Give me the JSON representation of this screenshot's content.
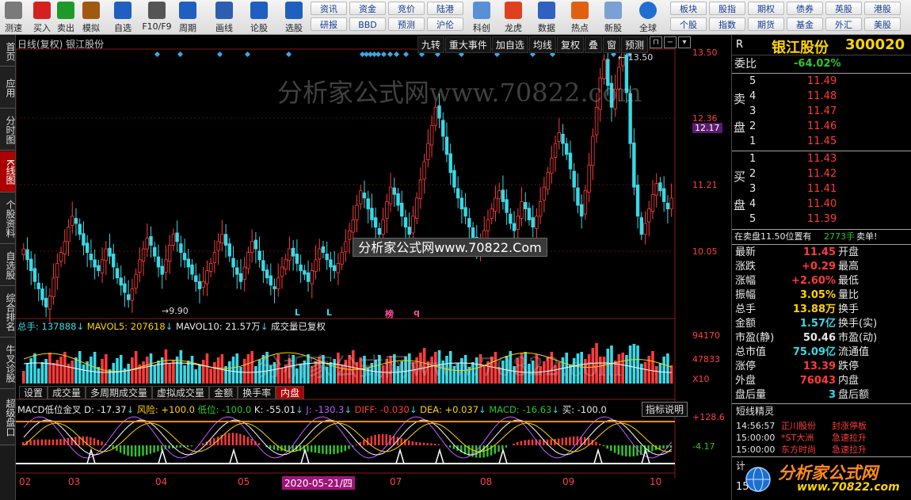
{
  "toolbar": {
    "buttons": [
      {
        "label": "测速",
        "icon": "speed-test-icon"
      },
      {
        "label": "买入",
        "icon": "buy-icon"
      },
      {
        "label": "卖出",
        "icon": "sell-icon"
      },
      {
        "label": "模拟",
        "icon": "hammer-icon"
      },
      {
        "label": "自选",
        "icon": "star-icon"
      },
      {
        "label": "F10/F9",
        "icon": "f10-icon"
      },
      {
        "label": "周期",
        "icon": "clock-icon"
      },
      {
        "label": "画线",
        "icon": "pen-icon"
      },
      {
        "label": "论股",
        "icon": "discuss-icon"
      },
      {
        "label": "选股",
        "icon": "select-stock-icon"
      }
    ],
    "grid1": [
      "资讯",
      "资金",
      "竞价",
      "陆港",
      "研报",
      "BBD",
      "预测",
      "沪伦"
    ],
    "buttons2": [
      {
        "label": "科创",
        "icon": "kechuang-icon"
      },
      {
        "label": "龙虎",
        "icon": "dragon-tiger-icon"
      },
      {
        "label": "数据",
        "icon": "data-icon"
      },
      {
        "label": "热点",
        "icon": "hotspot-icon"
      },
      {
        "label": "新股",
        "icon": "ipo-icon"
      },
      {
        "label": "全球",
        "icon": "globe-icon"
      }
    ],
    "grid2": [
      "板块",
      "股指",
      "期权",
      "债券",
      "英股",
      "港股",
      "个股",
      "指数",
      "期货",
      "基金",
      "外汇",
      "美股"
    ]
  },
  "left_tabs": [
    "首页",
    "应用",
    "分时图",
    "K线图",
    "个股资料",
    "自选股",
    "综合排名",
    "牛叉诊股",
    "超级盘口"
  ],
  "chart": {
    "title": "日线(复权) 银江股份",
    "tabs": [
      "九转",
      "重大事件",
      "加自选",
      "均线",
      "复权",
      "叠",
      "窗",
      "预测"
    ],
    "price_axis": [
      "13.50",
      "12.36",
      "12.17",
      "11.21",
      "10.05"
    ],
    "high_label": "13.50",
    "low_label": "9.90",
    "marks": [
      "L",
      "L",
      "榜",
      "q"
    ],
    "vol_line": {
      "label": "总手: 137888",
      "ma5": "MAVOL5: 207618",
      "ma10": "MAVOL10: 21.57万",
      "note": "成交量已复权"
    },
    "vol_axis": [
      "94170",
      "47833",
      "X10"
    ],
    "vol_tabs": [
      "设置",
      "成交量",
      "多周期成交量",
      "虚拟成交量",
      "金额",
      "换手率",
      "内盘"
    ],
    "macd_line": {
      "name": "MACD低位金叉",
      "d": "D: -17.37",
      "risk": "风险: +100.0",
      "low": "低位: -100.0",
      "k": "K: -55.01",
      "j": "J: -130.3",
      "diff": "DIFF: -0.030",
      "dea": "DEA: +0.037",
      "macd": "MACD: -16.63",
      "buy": "买: -100.0"
    },
    "macd_axis": [
      "+128.6",
      "-4.17"
    ],
    "ind_button": "指标说明",
    "x_labels": [
      "02",
      "03",
      "04",
      "05",
      "2020-05-21/四",
      "07",
      "08",
      "09",
      "10"
    ],
    "watermark": "分析家公式网www.70822.com",
    "overlay_url": "分析家公式网www.70822.Com"
  },
  "quote": {
    "r_label": "R",
    "name": "银江股份",
    "code": "300020",
    "weibi_label": "委比",
    "weibi": "-64.02%",
    "sell_label": "卖盘",
    "buy_label": "买盘",
    "asks": [
      {
        "lv": "5",
        "price": "11.49"
      },
      {
        "lv": "4",
        "price": "11.48"
      },
      {
        "lv": "3",
        "price": "11.47"
      },
      {
        "lv": "2",
        "price": "11.46"
      },
      {
        "lv": "1",
        "price": "11.45"
      }
    ],
    "bids": [
      {
        "lv": "1",
        "price": "11.43"
      },
      {
        "lv": "2",
        "price": "11.42"
      },
      {
        "lv": "3",
        "price": "11.41"
      },
      {
        "lv": "4",
        "price": "11.40"
      },
      {
        "lv": "5",
        "price": "11.39"
      }
    ],
    "notice": "在卖盘11.50位置有",
    "notice_qty": "2773手",
    "notice_tail": "卖单!",
    "stats": [
      {
        "k1": "最新",
        "v1": "11.45",
        "c1": "red",
        "k2": "开盘"
      },
      {
        "k1": "涨跌",
        "v1": "+0.29",
        "c1": "red",
        "k2": "最高"
      },
      {
        "k1": "涨幅",
        "v1": "+2.60%",
        "c1": "red",
        "k2": "最低"
      },
      {
        "k1": "振幅",
        "v1": "3.05%",
        "c1": "yellow",
        "k2": "量比"
      },
      {
        "k1": "总手",
        "v1": "13.88万",
        "c1": "yellow",
        "k2": "换手"
      },
      {
        "k1": "金额",
        "v1": "1.57亿",
        "c1": "cyan",
        "k2": "换手(实)"
      },
      {
        "k1": "市盈(静)",
        "v1": "50.46",
        "c1": "white",
        "k2": "市盈(动)"
      },
      {
        "k1": "总市值",
        "v1": "75.09亿",
        "c1": "cyan",
        "k2": "流通值"
      },
      {
        "k1": "涨停",
        "v1": "13.39",
        "c1": "red",
        "k2": "跌停"
      },
      {
        "k1": "外盘",
        "v1": "76043",
        "c1": "red",
        "k2": "内盘"
      },
      {
        "k1": "盘后量",
        "v1": "3",
        "c1": "cyan",
        "k2": "盘后额"
      }
    ],
    "jingxuan_title": "短线精灵",
    "jingxuan": [
      {
        "time": "14:56:57",
        "name": "正川股份",
        "event": "封涨停板"
      },
      {
        "time": "15:00:00",
        "name": "*ST大洲",
        "event": "急速拉升"
      },
      {
        "time": "15:00:00",
        "name": "东方时尚",
        "event": "急速拉升"
      }
    ],
    "calc_label": "计",
    "bottom_time": "15:",
    "brand": "分析家公式网",
    "brand_url": "www.70822.com"
  },
  "colors": {
    "up": "#ff3b3b",
    "down": "#39d9e6",
    "accent": "#a00000"
  },
  "chart_data": {
    "type": "candlestick",
    "price_range": [
      9.9,
      13.5
    ],
    "closes": [
      10.75,
      10.6,
      10.45,
      10.3,
      10.2,
      10.05,
      9.95,
      10.1,
      10.35,
      10.55,
      10.7,
      10.85,
      11.05,
      11.2,
      11.1,
      10.95,
      10.8,
      10.7,
      10.6,
      10.5,
      10.45,
      10.6,
      10.75,
      10.65,
      10.5,
      10.35,
      10.25,
      10.15,
      10.05,
      10.2,
      10.4,
      10.6,
      10.75,
      10.9,
      10.8,
      10.65,
      10.5,
      10.4,
      10.6,
      10.8,
      10.95,
      10.85,
      10.7,
      10.6,
      10.5,
      10.4,
      10.3,
      10.2,
      10.3,
      10.45,
      10.55,
      10.7,
      10.85,
      10.95,
      10.8,
      10.65,
      10.5,
      10.4,
      10.3,
      10.5,
      10.7,
      10.85,
      10.75,
      10.6,
      10.45,
      10.35,
      10.25,
      10.2,
      10.35,
      10.5,
      10.6,
      10.75,
      10.65,
      10.55,
      10.45,
      10.4,
      10.3,
      10.45,
      10.6,
      10.75,
      10.7,
      10.6,
      10.5,
      10.45,
      10.55,
      10.7,
      10.85,
      11.0,
      11.15,
      11.35,
      11.55,
      11.45,
      11.3,
      11.15,
      11.05,
      10.95,
      11.15,
      11.4,
      11.6,
      11.5,
      11.35,
      11.2,
      11.05,
      10.95,
      11.2,
      11.45,
      11.7,
      11.95,
      12.2,
      12.45,
      12.7,
      12.55,
      12.3,
      12.05,
      11.8,
      11.6,
      11.45,
      11.3,
      11.2,
      11.05,
      10.9,
      10.75,
      10.85,
      11.0,
      11.15,
      11.3,
      11.45,
      11.55,
      11.4,
      11.25,
      11.1,
      11.0,
      11.2,
      11.4,
      11.3,
      11.15,
      11.05,
      11.2,
      11.4,
      11.6,
      11.8,
      12.0,
      12.2,
      12.35,
      12.2,
      12.05,
      11.85,
      11.6,
      11.35,
      11.2,
      11.55,
      11.9,
      12.3,
      12.7,
      13.1,
      13.35,
      13.0,
      12.7,
      12.95,
      13.25,
      13.45,
      12.9,
      12.2,
      11.6,
      11.2,
      10.95,
      11.1,
      11.3,
      11.5,
      11.65,
      11.55,
      11.4,
      11.3,
      11.45
    ]
  }
}
